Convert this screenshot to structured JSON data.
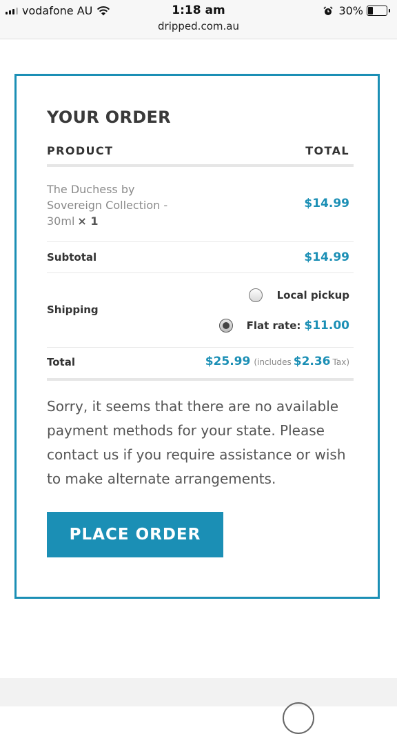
{
  "status_bar": {
    "carrier": "vodafone AU",
    "time": "1:18 am",
    "url": "dripped.com.au",
    "battery": "30%",
    "battery_level": 0.3
  },
  "order": {
    "title": "YOUR ORDER",
    "header_product": "PRODUCT",
    "header_total": "TOTAL",
    "product_name": "The Duchess by Sovereign Collection - 30ml",
    "product_qty": "× 1",
    "product_price": "$14.99",
    "subtotal_label": "Subtotal",
    "subtotal_value": "$14.99",
    "shipping_label": "Shipping",
    "shipping_options": [
      {
        "label": "Local pickup",
        "price": "",
        "selected": false
      },
      {
        "label": "Flat rate:",
        "price": "$11.00",
        "selected": true
      }
    ],
    "total_label": "Total",
    "total_value": "$25.99",
    "includes_text": "(includes",
    "tax_value": "$2.36",
    "tax_text": "Tax)",
    "notice": "Sorry, it seems that there are no available payment methods for your state. Please contact us if you require assistance or wish to make alternate arrangements.",
    "place_order_label": "PLACE ORDER"
  },
  "colors": {
    "accent": "#1b8fb5",
    "text": "#444444"
  },
  "icons": [
    "signal-icon",
    "wifi-icon",
    "alarm-icon",
    "battery-icon",
    "radio-unchecked",
    "radio-checked"
  ]
}
